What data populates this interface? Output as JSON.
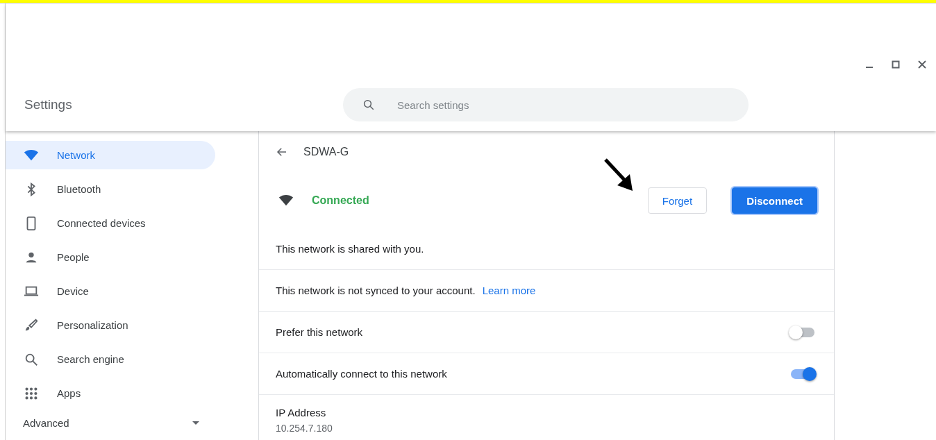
{
  "window": {
    "title": "Settings"
  },
  "search": {
    "placeholder": "Search settings"
  },
  "sidebar": {
    "items": [
      {
        "label": "Network",
        "selected": true
      },
      {
        "label": "Bluetooth",
        "selected": false
      },
      {
        "label": "Connected devices",
        "selected": false
      },
      {
        "label": "People",
        "selected": false
      },
      {
        "label": "Device",
        "selected": false
      },
      {
        "label": "Personalization",
        "selected": false
      },
      {
        "label": "Search engine",
        "selected": false
      },
      {
        "label": "Apps",
        "selected": false
      }
    ],
    "advanced": {
      "label": "Advanced",
      "expanded": false
    }
  },
  "network": {
    "name": "SDWA-G",
    "status": "Connected",
    "buttons": [
      {
        "label": "Forget",
        "kind": "outline"
      },
      {
        "label": "Disconnect",
        "kind": "primary"
      }
    ]
  },
  "rows": [
    {
      "kind": "text",
      "text": "This network is shared with you."
    },
    {
      "kind": "text",
      "text": "This network is not synced to your account.",
      "link": "Learn more"
    },
    {
      "kind": "toggle",
      "text": "Prefer this network",
      "on": false
    },
    {
      "kind": "toggle",
      "text": "Automatically connect to this network",
      "on": true
    },
    {
      "kind": "field",
      "text": "IP Address",
      "value": "10.254.7.180"
    }
  ]
}
